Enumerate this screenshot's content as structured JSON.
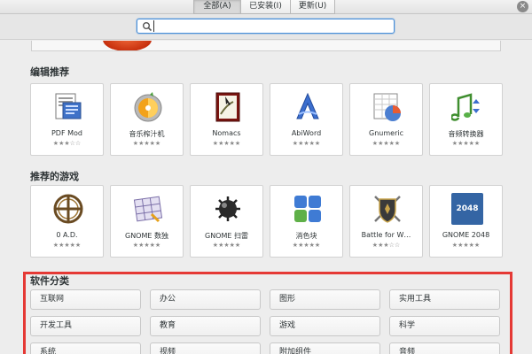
{
  "tabs": [
    {
      "label": "全部(A)",
      "active": true
    },
    {
      "label": "已安装(I)",
      "active": false
    },
    {
      "label": "更新(U)",
      "active": false
    }
  ],
  "search": {
    "placeholder": "",
    "value": ""
  },
  "editors_picks": {
    "title": "编辑推荐",
    "apps": [
      {
        "name": "PDF Mod",
        "stars": "★★★☆☆",
        "icon": "pdf-mod-icon"
      },
      {
        "name": "音乐榨汁机",
        "stars": "★★★★★",
        "icon": "sound-juicer-icon"
      },
      {
        "name": "Nomacs",
        "stars": "★★★★★",
        "icon": "nomacs-icon"
      },
      {
        "name": "AbiWord",
        "stars": "★★★★★",
        "icon": "abiword-icon"
      },
      {
        "name": "Gnumeric",
        "stars": "★★★★★",
        "icon": "gnumeric-icon"
      },
      {
        "name": "音频转换器",
        "stars": "★★★★★",
        "icon": "audio-converter-icon"
      }
    ]
  },
  "games": {
    "title": "推荐的游戏",
    "apps": [
      {
        "name": "0 A.D.",
        "stars": "★★★★★",
        "icon": "0ad-icon"
      },
      {
        "name": "GNOME 数独",
        "stars": "★★★★★",
        "icon": "gnome-sudoku-icon"
      },
      {
        "name": "GNOME 扫雷",
        "stars": "★★★★★",
        "icon": "gnome-mines-icon"
      },
      {
        "name": "消色块",
        "stars": "★★★★★",
        "icon": "swell-foop-icon"
      },
      {
        "name": "Battle for W…",
        "stars": "★★★☆☆",
        "icon": "wesnoth-icon"
      },
      {
        "name": "GNOME 2048",
        "stars": "★★★★★",
        "icon": "gnome-2048-icon",
        "icon_text": "2048"
      }
    ]
  },
  "categories": {
    "title": "软件分类",
    "items": [
      "互联网",
      "办公",
      "图形",
      "实用工具",
      "开发工具",
      "教育",
      "游戏",
      "科学",
      "系统",
      "视频",
      "附加组件",
      "音频"
    ]
  },
  "colors": {
    "accent": "#4a90d9",
    "highlight": "#e53935"
  }
}
